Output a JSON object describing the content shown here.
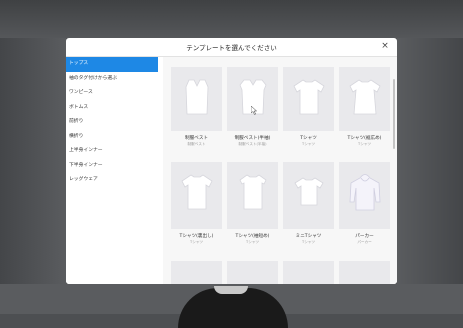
{
  "modal": {
    "title": "テンプレートを選んでください",
    "close_label": "×"
  },
  "sidebar": {
    "items": [
      {
        "label": "トップス",
        "active": true
      },
      {
        "label": "袖のタグ付けから選ぶ",
        "active": false
      },
      {
        "label": "ワンピース",
        "active": false
      },
      {
        "label": "ボトムス",
        "active": false
      },
      {
        "label": "前折り",
        "active": false
      },
      {
        "label": "横折り",
        "active": false
      },
      {
        "label": "上半身インナー",
        "active": false
      },
      {
        "label": "下半身インナー",
        "active": false
      },
      {
        "label": "レッグウェア",
        "active": false
      }
    ]
  },
  "templates": [
    {
      "label": "制服ベスト",
      "sub": "制服ベスト"
    },
    {
      "label": "制服ベスト(半袖)",
      "sub": "制服ベスト(半袖)"
    },
    {
      "label": "Tシャツ",
      "sub": "Tシャツ"
    },
    {
      "label": "Tシャツ(裾広め)",
      "sub": "Tシャツ"
    },
    {
      "label": "Tシャツ(裏出し)",
      "sub": "Tシャツ"
    },
    {
      "label": "Tシャツ(袖短め)",
      "sub": "Tシャツ"
    },
    {
      "label": "ミニTシャツ",
      "sub": "Tシャツ"
    },
    {
      "label": "パーカー",
      "sub": "パーカー"
    }
  ],
  "colors": {
    "accent": "#1e88e5",
    "backdrop": "#4d4f52"
  },
  "icons": {
    "close": "close-icon",
    "template_thumb": "tshirt-icon",
    "cursor": "pointer-cursor-icon"
  }
}
